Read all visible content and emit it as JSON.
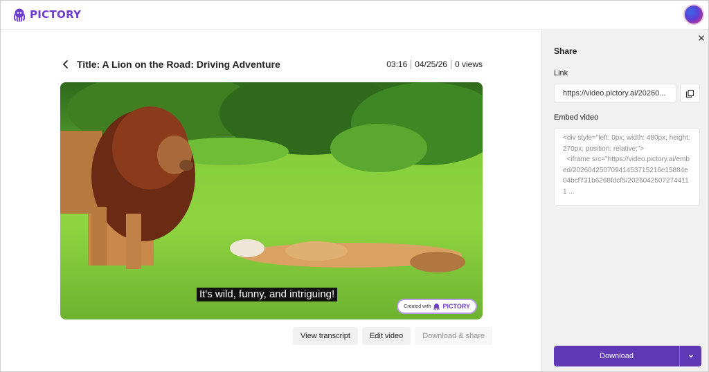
{
  "app": {
    "logo_text": "PICTORY",
    "brand_color": "#6c3bd0",
    "accent_button": "#5e38b5"
  },
  "header": {
    "avatar": "user-avatar"
  },
  "video": {
    "title": "Title: A Lion on the Road: Driving Adventure",
    "duration": "03:16",
    "date": "04/25/26",
    "views": "0 views",
    "caption": "It's wild, funny, and intriguing!",
    "badge_prefix": "Created with",
    "badge_logo": "PICTORY"
  },
  "actions": {
    "view_transcript": "View transcript",
    "edit_video": "Edit video",
    "download_share": "Download & share"
  },
  "share": {
    "title": "Share",
    "link_label": "Link",
    "link_value": "https://video.pictory.ai/20260...",
    "embed_label": "Embed video",
    "embed_value": "<div style=\"left: 0px; width: 480px; height: 270px; position: relative;\">\n  <iframe src=\"https://video.pictory.ai/embed/20260425070941453715216e15884e04bcf731b6268fdcf5/20260425072744111 ...",
    "download_label": "Download"
  },
  "icons": [
    "logo-octopus-icon",
    "back-chevron-icon",
    "close-icon",
    "copy-icon",
    "chevron-down-icon"
  ]
}
